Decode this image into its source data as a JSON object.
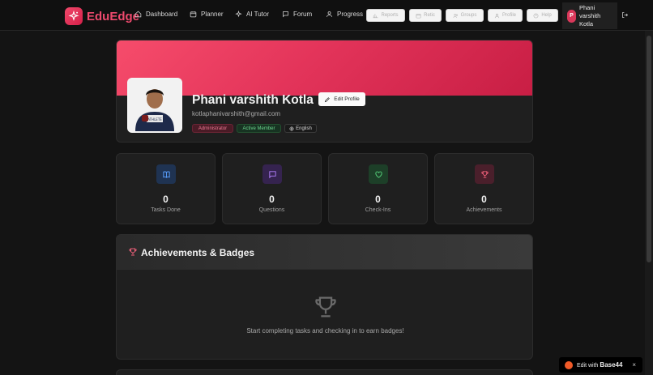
{
  "app": {
    "name": "EduEdge",
    "accent": "#ef4a6e"
  },
  "nav": {
    "links": [
      {
        "label": "Dashboard",
        "icon": "home-icon"
      },
      {
        "label": "Planner",
        "icon": "calendar-icon"
      },
      {
        "label": "AI Tutor",
        "icon": "sparkles-icon"
      },
      {
        "label": "Forum",
        "icon": "chat-icon"
      },
      {
        "label": "Progress",
        "icon": "user-icon"
      }
    ],
    "buttons": [
      {
        "label": "Reports",
        "icon": "chart-icon"
      },
      {
        "label": "Retic",
        "icon": "calendar-icon"
      },
      {
        "label": "Groups",
        "icon": "users-icon"
      },
      {
        "label": "Profile",
        "icon": "user-icon"
      },
      {
        "label": "Help",
        "icon": "help-icon"
      }
    ],
    "user": {
      "initial": "P",
      "name": "Phani varshith Kotla"
    }
  },
  "profile": {
    "name": "Phani varshith Kotla",
    "edit_label": "Edit Profile",
    "email": "kotlaphanivarshith@gmail.com",
    "badges": {
      "role": "Administrator",
      "status": "Active Member",
      "language": "English"
    }
  },
  "stats": [
    {
      "value": "0",
      "label": "Tasks Done",
      "icon": "book-icon",
      "color": "#5aa0ff",
      "bg": "#1f3352"
    },
    {
      "value": "0",
      "label": "Questions",
      "icon": "message-icon",
      "color": "#b480ff",
      "bg": "#35234f"
    },
    {
      "value": "0",
      "label": "Check-Ins",
      "icon": "heart-icon",
      "color": "#55d07a",
      "bg": "#1d3f28"
    },
    {
      "value": "0",
      "label": "Achievements",
      "icon": "trophy-icon",
      "color": "#f0607a",
      "bg": "#4a1f2b"
    }
  ],
  "achievements": {
    "title": "Achievements & Badges",
    "empty_text": "Start completing tasks and checking in to earn badges!"
  },
  "base44": {
    "prefix": "Edit with",
    "brand": "Base44",
    "close": "×"
  }
}
